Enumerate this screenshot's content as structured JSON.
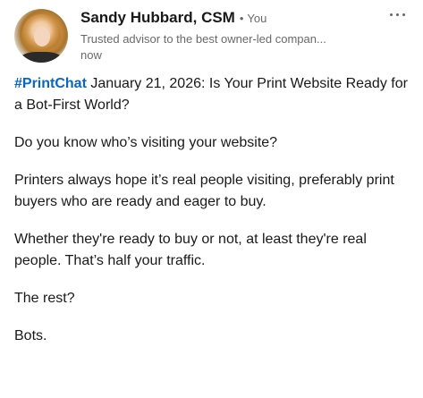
{
  "author": {
    "name": "Sandy Hubbard, CSM",
    "bullet": "•",
    "degree": "You",
    "headline": "Trusted advisor to the best owner-led compan...",
    "time": "now"
  },
  "post": {
    "hashtag": "#PrintChat",
    "line1_rest": " January 21, 2026: Is Your Print Website Ready for a Bot-First World?",
    "p2": "Do you know who’s visiting your website?",
    "p3": "Printers always hope it’s real people visiting, preferably print buyers who are ready and eager to buy.",
    "p4": "Whether they're ready to buy or not, at least they're real people. That’s half your traffic.",
    "p5": "The rest?",
    "p6": "Bots."
  },
  "icons": {
    "more": "more-horizontal-icon",
    "avatar": "profile-photo"
  },
  "colors": {
    "hashtag": "#0a66c2",
    "text": "#191919",
    "muted": "#666666"
  }
}
